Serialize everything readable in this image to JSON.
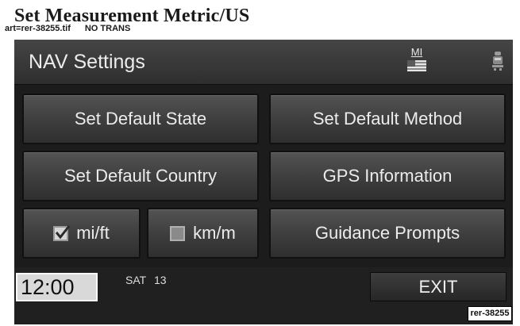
{
  "heading": "Set Measurement Metric/US",
  "art_ref": {
    "file": "art=rer-38255.tif",
    "note": "NO TRANS"
  },
  "header": {
    "title": "NAV Settings",
    "units_indicator": "MI"
  },
  "buttons": {
    "set_default_state": "Set Default State",
    "set_default_method": "Set Default Method",
    "set_default_country": "Set Default Country",
    "gps_information": "GPS Information",
    "guidance_prompts": "Guidance Prompts"
  },
  "units": {
    "miles": {
      "label": "mi/ft",
      "checked": true
    },
    "kilometers": {
      "label": "km/m",
      "checked": false
    }
  },
  "status_bar": {
    "clock": "12:00",
    "day": "SAT",
    "date": "13",
    "exit_label": "EXIT"
  },
  "ref_label": "rer-38255",
  "icons": {
    "flag": "us-flag-icon",
    "vehicle": "vehicle-icon",
    "checked": "checkbox-checked-icon",
    "unchecked": "checkbox-unchecked-icon"
  },
  "colors": {
    "screen_bg": "#1c1c1c",
    "button_bg": "#454545",
    "text": "#ececec",
    "clock_bg": "#d9d9d9"
  }
}
